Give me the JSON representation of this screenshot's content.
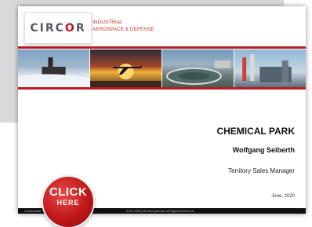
{
  "logo": {
    "text_before": "CIRC",
    "text_o": "O",
    "text_after": "R"
  },
  "tagline": {
    "line1": "INDUSTRIAL",
    "line2": "AEROSPACE & DEFENSE"
  },
  "colors": {
    "brand_red": "#b81c22",
    "backdrop": "#d9d9dc"
  },
  "slide": {
    "title": "CHEMICAL PARK",
    "presenter": "Wolfgang Seiberth",
    "role": "Territory Sales Manager",
    "date": "June, 2020"
  },
  "footer": {
    "confidential": "Confidential",
    "copyright": "2020 CIRCOR International. All Rights Reserved."
  },
  "click_button": {
    "line1": "CLICK",
    "line2": "HERE"
  },
  "banner_photos": [
    "icebreaker-ship",
    "airplane-sunset",
    "water-treatment-plant",
    "power-plant"
  ]
}
